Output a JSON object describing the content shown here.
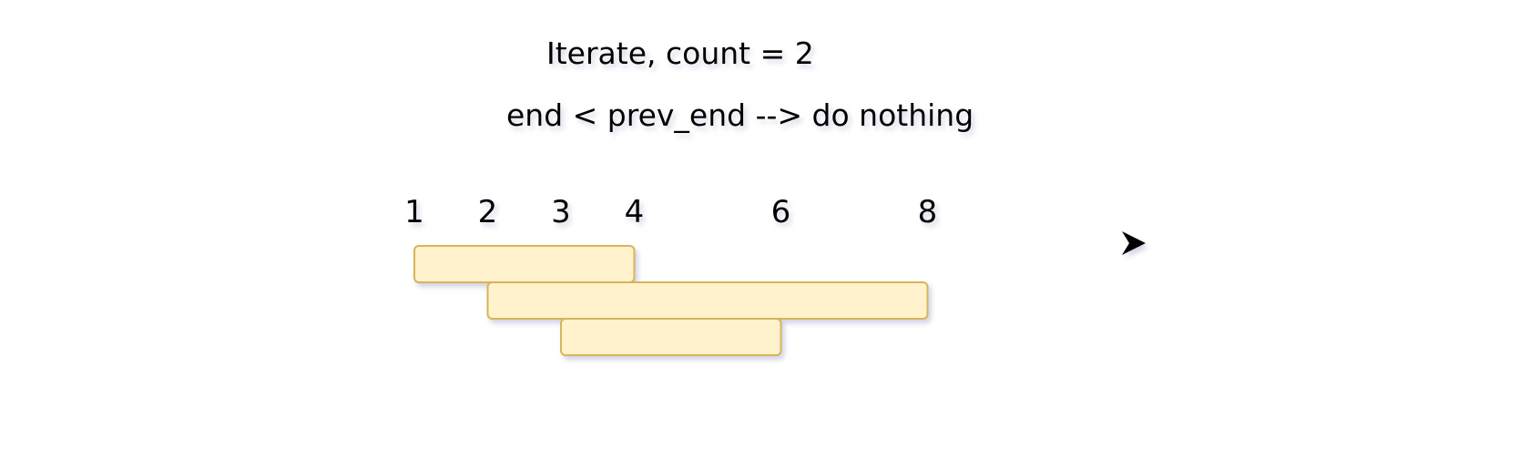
{
  "diagram": {
    "title": "Iterate, count = 2",
    "subtitle": "end < prev_end --> do nothing",
    "axis": {
      "ticks": [
        1,
        2,
        3,
        4,
        6,
        8
      ]
    },
    "intervals": [
      {
        "start": 1,
        "end": 4
      },
      {
        "start": 2,
        "end": 8
      },
      {
        "start": 3,
        "end": 6
      }
    ]
  }
}
